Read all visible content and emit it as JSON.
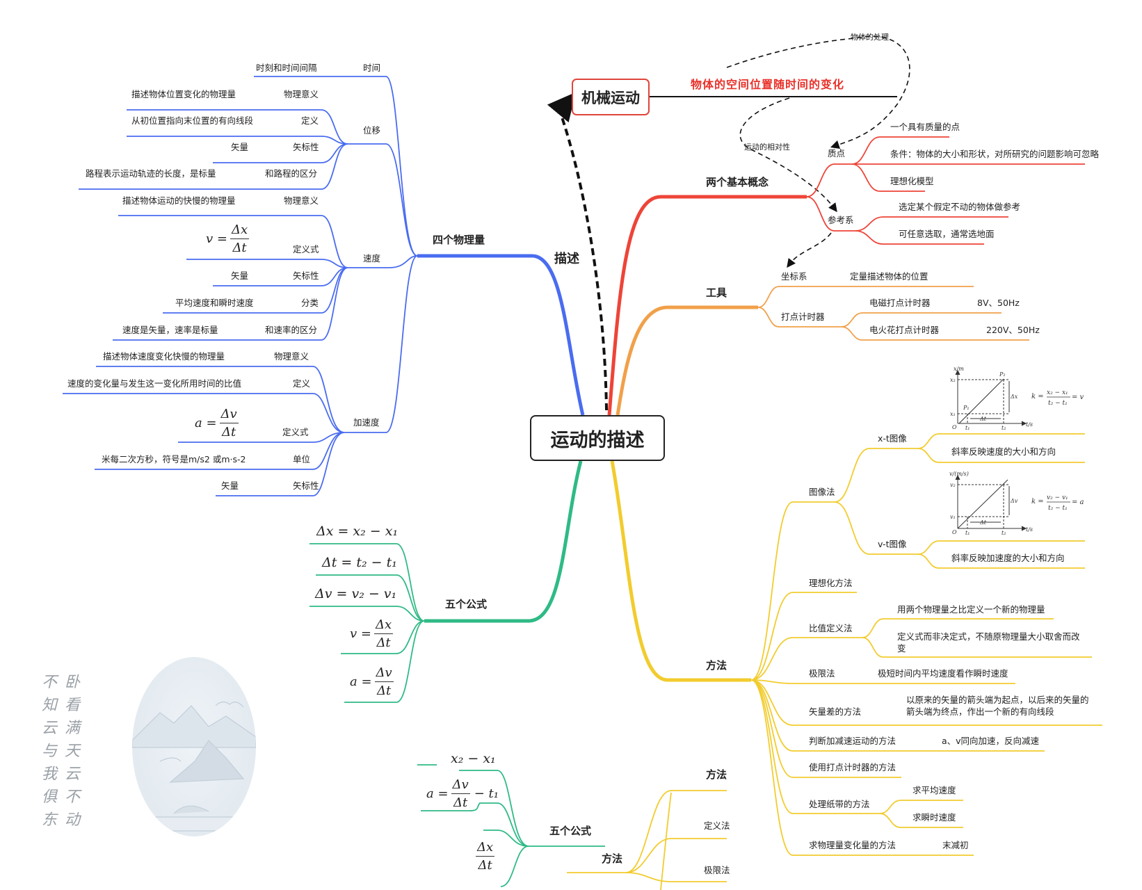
{
  "root": {
    "label": "运动的描述"
  },
  "mechanical": {
    "label": "机械运动",
    "definition": "物体的空间位置随时间的变化",
    "link_label": "描述",
    "annotations": [
      "物体的处理",
      "运动的相对性"
    ]
  },
  "colors": {
    "blue": "#4a6cf0",
    "red": "#ee4438",
    "orange": "#f1a04a",
    "yellow": "#f2cc2e",
    "green": "#2fba86",
    "dashed": "#111111",
    "red_text": "#e8312a"
  },
  "four_quantities": {
    "label": "四个物理量",
    "groups": [
      {
        "label": "时间",
        "items": [
          {
            "key": "",
            "value": "时刻和时间间隔"
          }
        ]
      },
      {
        "label": "位移",
        "items": [
          {
            "key": "物理意义",
            "value": "描述物体位置变化的物理量"
          },
          {
            "key": "定义",
            "value": "从初位置指向末位置的有向线段"
          },
          {
            "key": "矢标性",
            "value": "矢量"
          },
          {
            "key": "和路程的区分",
            "value": "路程表示运动轨迹的长度，是标量"
          }
        ]
      },
      {
        "label": "速度",
        "items": [
          {
            "key": "物理意义",
            "value": "描述物体运动的快慢的物理量"
          },
          {
            "key": "定义式",
            "value": "v = Δx / Δt"
          },
          {
            "key": "矢标性",
            "value": "矢量"
          },
          {
            "key": "分类",
            "value": "平均速度和瞬时速度"
          },
          {
            "key": "和速率的区分",
            "value": "速度是矢量，速率是标量"
          }
        ]
      },
      {
        "label": "加速度",
        "items": [
          {
            "key": "物理意义",
            "value": "描述物体速度变化快慢的物理量"
          },
          {
            "key": "定义",
            "value": "速度的变化量与发生这一变化所用时间的比值"
          },
          {
            "key": "定义式",
            "value": "a = Δv / Δt"
          },
          {
            "key": "单位",
            "value": "米每二次方秒，符号是m/s2 或m·s-2"
          },
          {
            "key": "矢标性",
            "value": "矢量"
          }
        ]
      }
    ],
    "math": {
      "v_lhs": "v =",
      "v_num": "Δx",
      "v_den": "Δt",
      "a_lhs": "a =",
      "a_num": "Δv",
      "a_den": "Δt"
    }
  },
  "five_formulas": {
    "label": "五个公式",
    "formulas": [
      "Δx = x₂ − x₁",
      "Δt = t₂ − t₁",
      "Δv = v₂ − v₁"
    ],
    "frac_v": {
      "lhs": "v =",
      "num": "Δx",
      "den": "Δt"
    },
    "frac_a": {
      "lhs": "a =",
      "num": "Δv",
      "den": "Δt"
    }
  },
  "two_concepts": {
    "label": "两个基本概念",
    "particle": {
      "label": "质点",
      "items": [
        "一个具有质量的点",
        "条件：物体的大小和形状，对所研究的问题影响可忽略",
        "理想化模型"
      ]
    },
    "reference": {
      "label": "参考系",
      "items": [
        "选定某个假定不动的物体做参考",
        "可任意选取，通常选地面"
      ]
    }
  },
  "tools": {
    "label": "工具",
    "coordinate": {
      "label": "坐标系",
      "value": "定量描述物体的位置"
    },
    "timer": {
      "label": "打点计时器",
      "items": [
        {
          "label": "电磁打点计时器",
          "value": "8V、50Hz"
        },
        {
          "label": "电火花打点计时器",
          "value": "220V、50Hz"
        }
      ]
    }
  },
  "methods": {
    "label": "方法",
    "graph": {
      "label": "图像法",
      "xt": {
        "label": "x-t图像",
        "desc": "斜率反映速度的大小和方向",
        "ylabel": "x/m",
        "xlabel": "t/s",
        "y1": "x₁",
        "y2": "x₂",
        "dy": "Δx",
        "dt": "Δt",
        "p1": "P₁",
        "p2": "P₂",
        "k": "k =",
        "knum": "x₂ − x₁",
        "kden": "t₂ − t₁",
        "kres": "= v",
        "origin": "O",
        "t1": "t₁",
        "t2": "t₂"
      },
      "vt": {
        "label": "v-t图像",
        "desc": "斜率反映加速度的大小和方向",
        "ylabel": "v/(m/s)",
        "xlabel": "t/s",
        "y1": "v₁",
        "y2": "v₂",
        "dy": "Δv",
        "dt": "Δt",
        "k": "k =",
        "knum": "v₂ − v₁",
        "kden": "t₂ − t₁",
        "kres": "= a",
        "origin": "O",
        "t1": "t₁",
        "t2": "t₂"
      }
    },
    "idealization": {
      "label": "理想化方法"
    },
    "ratio": {
      "label": "比值定义法",
      "items": [
        "用两个物理量之比定义一个新的物理量",
        "定义式而非决定式，不随原物理量大小取舍而改",
        "变"
      ]
    },
    "limit": {
      "label": "极限法",
      "value": "极短时间内平均速度看作瞬时速度"
    },
    "vector_diff": {
      "label": "矢量差的方法",
      "value_line1": "以原来的矢量的箭头端为起点，以后来的矢量的",
      "value_line2": "箭头端为终点，作出一个新的有向线段"
    },
    "accel_judge": {
      "label": "判断加减速运动的方法",
      "value": "a、v同向加速，反向减速"
    },
    "timer_use": {
      "label": "使用打点计时器的方法"
    },
    "tape": {
      "label": "处理纸带的方法",
      "items": [
        "求平均速度",
        "求瞬时速度"
      ]
    },
    "change": {
      "label": "求物理量变化量的方法",
      "value": "末减初"
    }
  },
  "ghost": {
    "five_formulas_label": "五个公式",
    "methods_label": "方法",
    "methods_sub": [
      "方法",
      "定义法",
      "极限法"
    ],
    "formula_top": "x₂ − x₁",
    "formula_a": {
      "lhs": "a =",
      "num": "Δv",
      "den": "Δt",
      "tail": "− t₁"
    },
    "formula_v": {
      "num": "Δx",
      "den": "Δt"
    }
  },
  "poem": {
    "col_right": [
      "卧",
      "看",
      "满",
      "天",
      "云",
      "不",
      "动"
    ],
    "col_left": [
      "不",
      "知",
      "云",
      "与",
      "我",
      "俱",
      "东"
    ]
  }
}
